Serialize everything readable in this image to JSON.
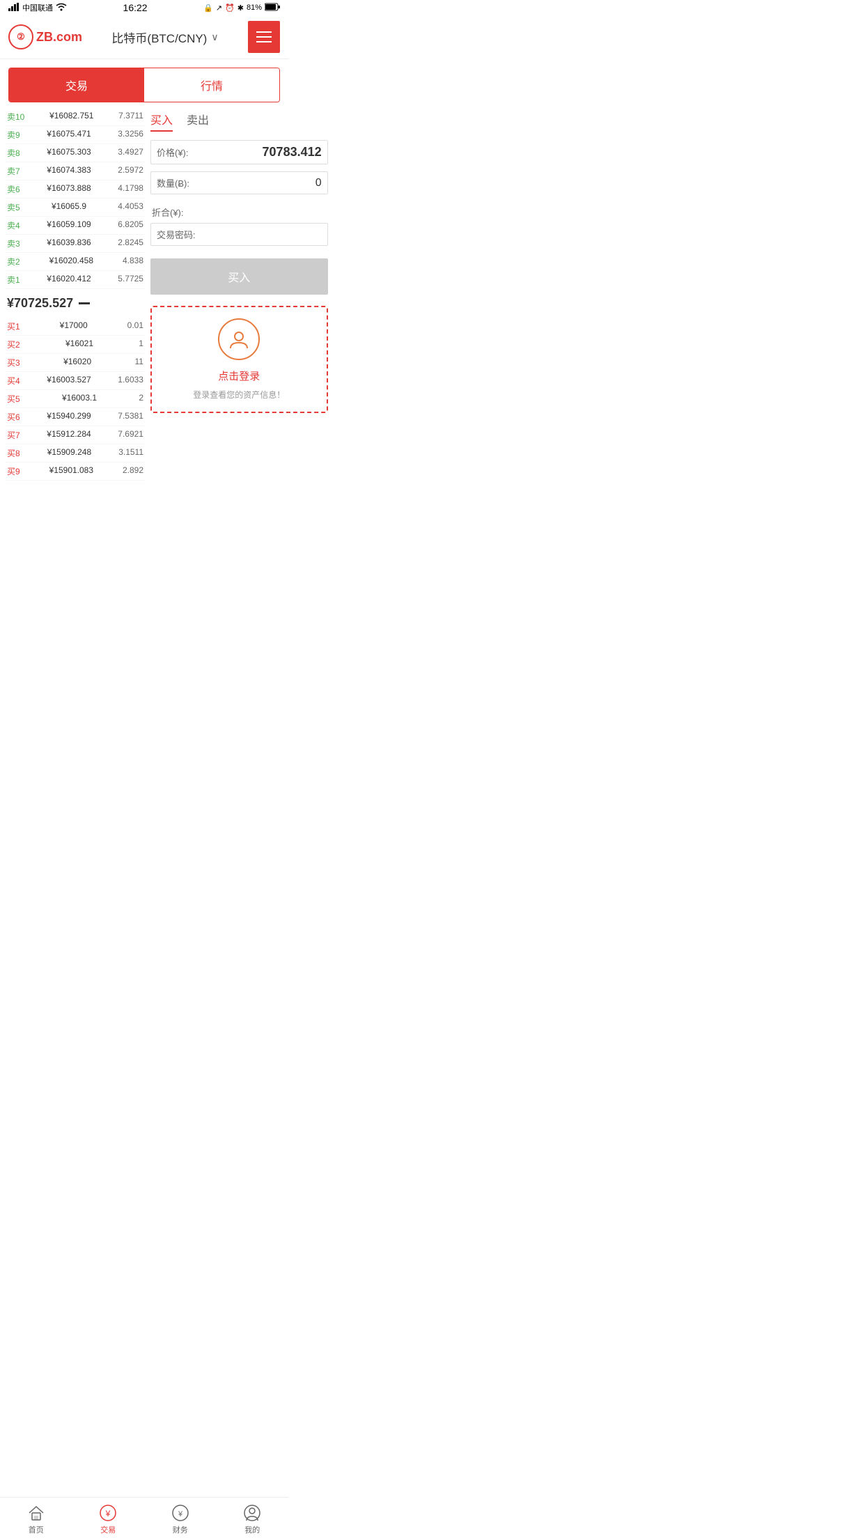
{
  "statusBar": {
    "carrier": "中国联通",
    "time": "16:22",
    "battery": "81%"
  },
  "header": {
    "title": "比特币(BTC/CNY)",
    "logoText": "ZB.com"
  },
  "tabs": {
    "trade": "交易",
    "market": "行情"
  },
  "sellOrders": [
    {
      "label": "卖10",
      "price": "¥16082.751",
      "qty": "7.3711"
    },
    {
      "label": "卖9",
      "price": "¥16075.471",
      "qty": "3.3256"
    },
    {
      "label": "卖8",
      "price": "¥16075.303",
      "qty": "3.4927"
    },
    {
      "label": "卖7",
      "price": "¥16074.383",
      "qty": "2.5972"
    },
    {
      "label": "卖6",
      "price": "¥16073.888",
      "qty": "4.1798"
    },
    {
      "label": "卖5",
      "price": "¥16065.9",
      "qty": "4.4053"
    },
    {
      "label": "卖4",
      "price": "¥16059.109",
      "qty": "6.8205"
    },
    {
      "label": "卖3",
      "price": "¥16039.836",
      "qty": "2.8245"
    },
    {
      "label": "卖2",
      "price": "¥16020.458",
      "qty": "4.838"
    },
    {
      "label": "卖1",
      "price": "¥16020.412",
      "qty": "5.7725"
    }
  ],
  "currentPrice": "¥70725.527",
  "buyOrders": [
    {
      "label": "买1",
      "price": "¥17000",
      "qty": "0.01"
    },
    {
      "label": "买2",
      "price": "¥16021",
      "qty": "1"
    },
    {
      "label": "买3",
      "price": "¥16020",
      "qty": "11"
    },
    {
      "label": "买4",
      "price": "¥16003.527",
      "qty": "1.6033"
    },
    {
      "label": "买5",
      "price": "¥16003.1",
      "qty": "2"
    },
    {
      "label": "买6",
      "price": "¥15940.299",
      "qty": "7.5381"
    },
    {
      "label": "买7",
      "price": "¥15912.284",
      "qty": "7.6921"
    },
    {
      "label": "买8",
      "price": "¥15909.248",
      "qty": "3.1511"
    },
    {
      "label": "买9",
      "price": "¥15901.083",
      "qty": "2.892"
    }
  ],
  "tradePanel": {
    "buyTab": "买入",
    "sellTab": "卖出",
    "priceLabel": "价格(¥):",
    "priceValue": "70783.412",
    "qtyLabel": "数量(Ƀ):",
    "qtyValue": "0",
    "totalLabel": "折合(¥):",
    "totalValue": "",
    "passwordLabel": "交易密码:",
    "buyBtn": "买入"
  },
  "loginPrompt": {
    "clickLogin": "点击登录",
    "hint": "登录查看您的资产信息！"
  },
  "bottomNav": [
    {
      "label": "首页",
      "icon": "home",
      "active": false
    },
    {
      "label": "交易",
      "icon": "trade",
      "active": true
    },
    {
      "label": "财务",
      "icon": "finance",
      "active": false
    },
    {
      "label": "我的",
      "icon": "profile",
      "active": false
    }
  ]
}
